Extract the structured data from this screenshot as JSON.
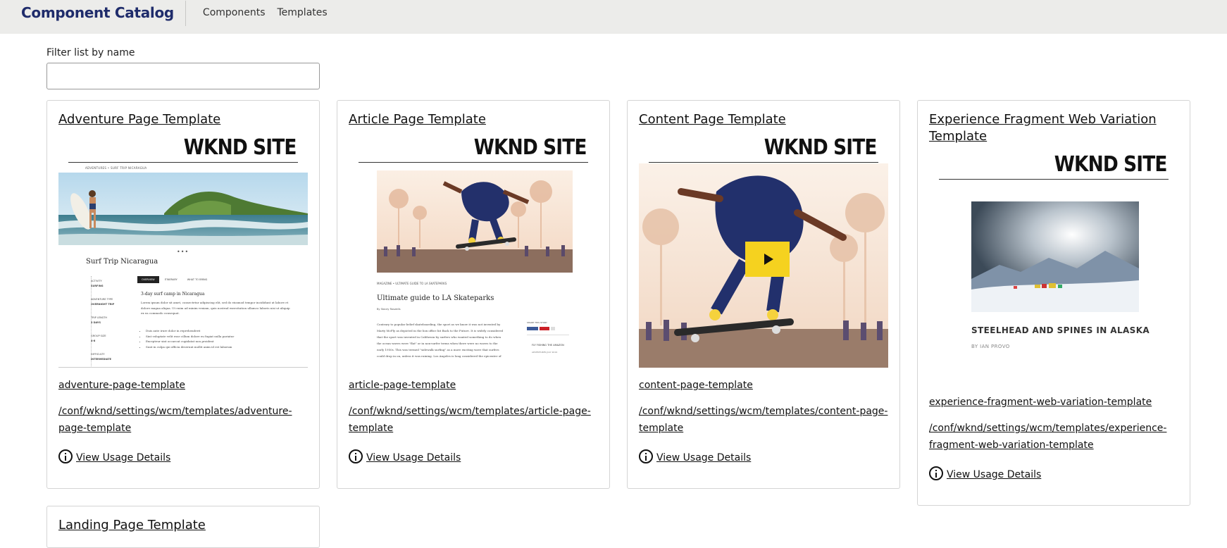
{
  "header": {
    "brand": "Component Catalog",
    "nav": [
      "Components",
      "Templates"
    ]
  },
  "filter": {
    "label": "Filter list by name",
    "value": "",
    "placeholder": ""
  },
  "common": {
    "usage_label": "View Usage Details",
    "site_logo": "WKND SITE"
  },
  "cards": [
    {
      "title": "Adventure Page Template",
      "name": "adventure-page-template",
      "path": "/conf/wknd/settings/wcm/templates/adventure-page-template",
      "thumb": {
        "breadcrumb": "ADVENTURES  •  SURF TRIP NICARAGUA",
        "heading": "Surf Trip Nicaragua",
        "tabs": [
          "OVERVIEW",
          "ITINERARY",
          "WHAT TO BRING"
        ],
        "subheading": "3-day surf camp in Nicaragua",
        "meta": [
          "ACTIVITY",
          "SURFING",
          "ADVENTURE TYPE",
          "OVERNIGHT TRIP",
          "TRIP LENGTH",
          "3 DAYS",
          "GROUP SIZE",
          "4-8",
          "DIFFICULTY",
          "INTERMEDIATE"
        ],
        "body": "Lorem ipsum dolor sit amet, consectetur adipiscing elit, sed do eiusmod tempor incididunt ut labore et dolore magna aliqua. Ut enim ad minim veniam, quis nostrud exercitation ullamco laboris nisi ut aliquip ex ea commodo consequat.",
        "bullets": [
          "Duis aute irure dolor in reprehenderit",
          "Sint voluptate velit esse cillum dolore eu fugiat nulla pariatur",
          "Excepteur sint occaecat cupidatat non proident",
          "Sunt in culpa qui officia deserunt mollit anim id est laborum"
        ]
      }
    },
    {
      "title": "Article Page Template",
      "name": "article-page-template",
      "path": "/conf/wknd/settings/wcm/templates/article-page-template",
      "thumb": {
        "breadcrumb": "MAGAZINE  •  ULTIMATE GUIDE TO LA SKATEPARKS",
        "heading": "Ultimate guide to LA Skateparks",
        "byline": "By Stacey Roswells",
        "body": "Contrary to popular belief skateboarding, the sport as we know it was not invented by Marty McFly as depicted in the box office hit Back to the Future. It is widely considered that the sport was invented in California by surfers who wanted something to do when the ocean waves were \"flat\" or in non-surfer terms when there were no waves to the early 1950s. This was termed \"sidewalk surfing\" as a more exciting wave that surfers could drop in on, unless it was raining. Los Angeles is long considered the epicenter of",
        "side_title": "SHARE THIS STORY",
        "side_item": "FLY FISHING THE AMAZON",
        "side_meta": "ADVENTURES  JULY 2019"
      }
    },
    {
      "title": "Content Page Template",
      "name": "content-page-template",
      "path": "/conf/wknd/settings/wcm/templates/content-page-template"
    },
    {
      "title": "Experience Fragment Web Variation Template",
      "name": "experience-fragment-web-variation-template",
      "path": "/conf/wknd/settings/wcm/templates/experience-fragment-web-variation-template",
      "thumb": {
        "heading": "STEELHEAD AND SPINES IN ALASKA",
        "byline": "BY IAN PROVO"
      }
    },
    {
      "title": "Landing Page Template"
    }
  ]
}
